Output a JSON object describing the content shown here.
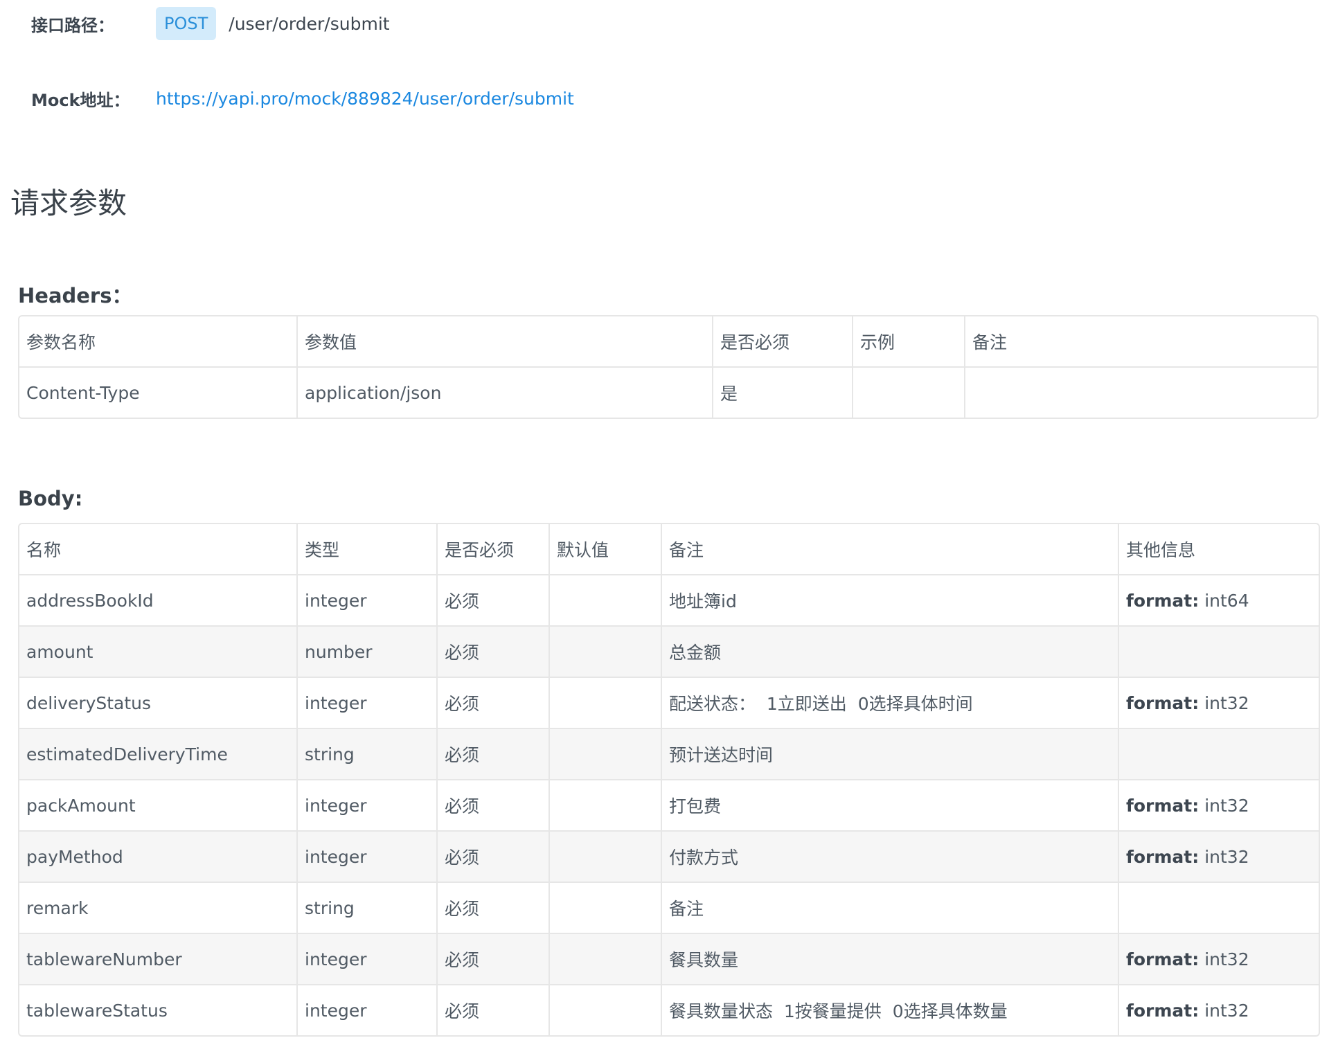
{
  "api": {
    "path_label": "接口路径：",
    "method": "POST",
    "path": "/user/order/submit",
    "mock_label": "Mock地址：",
    "mock_url": "https://yapi.pro/mock/889824/user/order/submit"
  },
  "request": {
    "title": "请求参数",
    "headers_title": "Headers：",
    "headers_columns": [
      "参数名称",
      "参数值",
      "是否必须",
      "示例",
      "备注"
    ],
    "headers_rows": [
      [
        "Content-Type",
        "application/json",
        "是",
        "",
        ""
      ]
    ],
    "body_title": "Body:",
    "body_columns": [
      "名称",
      "类型",
      "是否必须",
      "默认值",
      "备注",
      "其他信息"
    ],
    "body_rows": [
      {
        "name": "addressBookId",
        "type": "integer",
        "required": "必须",
        "default": "",
        "remark": "地址簿id",
        "format_key": "format:",
        "format_val": "int64"
      },
      {
        "name": "amount",
        "type": "number",
        "required": "必须",
        "default": "",
        "remark": "总金额",
        "format_key": "",
        "format_val": ""
      },
      {
        "name": "deliveryStatus",
        "type": "integer",
        "required": "必须",
        "default": "",
        "remark": "配送状态：  1立即送出  0选择具体时间",
        "format_key": "format:",
        "format_val": "int32"
      },
      {
        "name": "estimatedDeliveryTime",
        "type": "string",
        "required": "必须",
        "default": "",
        "remark": "预计送达时间",
        "format_key": "",
        "format_val": ""
      },
      {
        "name": "packAmount",
        "type": "integer",
        "required": "必须",
        "default": "",
        "remark": "打包费",
        "format_key": "format:",
        "format_val": "int32"
      },
      {
        "name": "payMethod",
        "type": "integer",
        "required": "必须",
        "default": "",
        "remark": "付款方式",
        "format_key": "format:",
        "format_val": "int32"
      },
      {
        "name": "remark",
        "type": "string",
        "required": "必须",
        "default": "",
        "remark": "备注",
        "format_key": "",
        "format_val": ""
      },
      {
        "name": "tablewareNumber",
        "type": "integer",
        "required": "必须",
        "default": "",
        "remark": "餐具数量",
        "format_key": "format:",
        "format_val": "int32"
      },
      {
        "name": "tablewareStatus",
        "type": "integer",
        "required": "必须",
        "default": "",
        "remark": "餐具数量状态  1按餐量提供  0选择具体数量",
        "format_key": "format:",
        "format_val": "int32"
      }
    ]
  },
  "colors": {
    "accent": "#1b88e0",
    "badge_bg": "#d3ebfb",
    "stripe": "#f6f6f6"
  }
}
